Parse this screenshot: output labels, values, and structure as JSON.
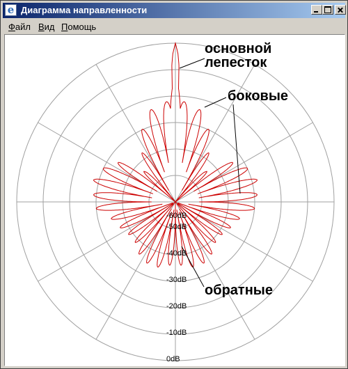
{
  "window": {
    "title": "Диаграмма направленности",
    "icon": "e",
    "controls": [
      "minimize-icon",
      "maximize-icon",
      "close-icon"
    ]
  },
  "menu": {
    "file": "Файл",
    "view": "Вид",
    "help": "Помощь"
  },
  "colors": {
    "pattern": "#cc0000",
    "grid": "#a0a0a0",
    "titlebar_start": "#0a246a",
    "titlebar_end": "#a6caf0"
  },
  "chart_data": {
    "type": "polar",
    "unit": "dB",
    "radial_range": [
      -60,
      0
    ],
    "ring_labels": [
      "-60dB",
      "-50dB",
      "-40dB",
      "-30dB",
      "-20dB",
      "-10dB",
      "0dB"
    ],
    "ring_values": [
      -60,
      -50,
      -40,
      -30,
      -20,
      -10,
      0
    ],
    "angular_grid_step_deg": 30,
    "series": [
      {
        "angle_deg": [
          0,
          1,
          3,
          5,
          8,
          10,
          12,
          15,
          18,
          20,
          22,
          25,
          30,
          35,
          40,
          45,
          50,
          55,
          60,
          65,
          70,
          75,
          80,
          85,
          90,
          95,
          100,
          110,
          120,
          130,
          140,
          150,
          160,
          170,
          175,
          180
        ],
        "envelope_db": [
          0,
          -4,
          -22,
          -22,
          -22,
          -23,
          -23,
          -24,
          -25,
          -26,
          -28,
          -30,
          -33,
          -38,
          -44,
          -44,
          -38,
          -34,
          -30,
          -30,
          -29,
          -28,
          -29,
          -29,
          -29,
          -30,
          -33,
          -37,
          -37,
          -40,
          -37,
          -35,
          -34,
          -35,
          -36,
          -38
        ]
      }
    ],
    "annotations": [
      {
        "text": "основной",
        "angle_deg": 0
      },
      {
        "text": "лепесток",
        "angle_deg": 0
      },
      {
        "text": "боковые",
        "angle_deg": 20
      },
      {
        "text": "обратные",
        "angle_deg": 180
      }
    ]
  }
}
